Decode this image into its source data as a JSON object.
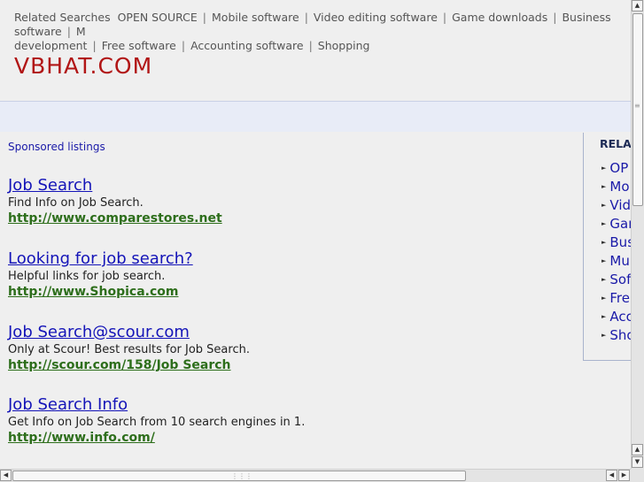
{
  "top_nav": {
    "label": "Related Searches",
    "links": [
      "OPEN SOURCE",
      "Mobile software",
      "Video editing software",
      "Game downloads",
      "Business software",
      "M",
      "development",
      "Free software",
      "Accounting software",
      "Shopping"
    ]
  },
  "site": {
    "logo": "VBHAT.COM"
  },
  "main": {
    "sponsored_label": "Sponsored listings",
    "listings": [
      {
        "title": "Job Search",
        "desc": "Find Info on Job Search.",
        "url": "http://www.comparestores.net"
      },
      {
        "title": "Looking for job search?",
        "desc": "Helpful links for job search.",
        "url": "http://www.Shopica.com"
      },
      {
        "title": "Job Search@scour.com",
        "desc": "Only at Scour! Best results for Job Search.",
        "url": "http://scour.com/158/Job Search"
      },
      {
        "title": "Job Search Info",
        "desc": "Get Info on Job Search from 10 search engines in 1.",
        "url": "http://www.info.com/"
      }
    ]
  },
  "sidebar": {
    "heading": "RELA",
    "items": [
      "OP",
      "Mo",
      "Vid",
      "Gar",
      "Bus",
      "Mu",
      "Sof",
      "Fre",
      "Acc",
      "Sho"
    ]
  },
  "colors": {
    "logo": "#b11515",
    "link": "#1414b8",
    "url": "#2d6e1b",
    "bar": "#e8ecf7"
  }
}
